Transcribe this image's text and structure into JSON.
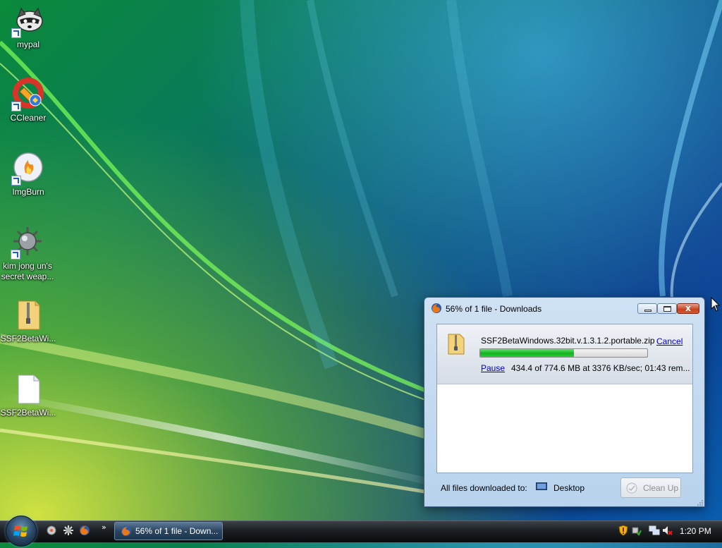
{
  "desktop": {
    "icons": [
      {
        "label": "mypal",
        "icon": "mypal-raccoon-icon"
      },
      {
        "label": "CCleaner",
        "icon": "ccleaner-icon"
      },
      {
        "label": "ImgBurn",
        "icon": "imgburn-disc-icon"
      },
      {
        "label": "kim jong un's secret weap...",
        "icon": "spiked-ball-icon"
      },
      {
        "label": "SSF2BetaWi...",
        "icon": "zip-folder-icon"
      },
      {
        "label": "SSF2BetaWi...",
        "icon": "blank-file-icon"
      }
    ]
  },
  "downloads_window": {
    "title": "56% of 1 file - Downloads",
    "close_glyph": "x",
    "item": {
      "filename": "SSF2BetaWindows.32bit.v.1.3.1.2.portable.zip",
      "cancel_label": "Cancel",
      "pause_label": "Pause",
      "status": "434.4 of 774.6 MB at 3376 KB/sec; 01:43 rem...",
      "progress": 0.56
    },
    "footer": {
      "label": "All files downloaded to:",
      "folder_name": "Desktop",
      "cleanup_label": "Clean Up"
    }
  },
  "taskbar": {
    "task_button_label": "56% of 1 file - Down...",
    "quick_launch_chevron": "»",
    "clock": "1:20 PM"
  },
  "colors": {
    "progress_fill": "#13b221",
    "link": "#0000cc"
  }
}
